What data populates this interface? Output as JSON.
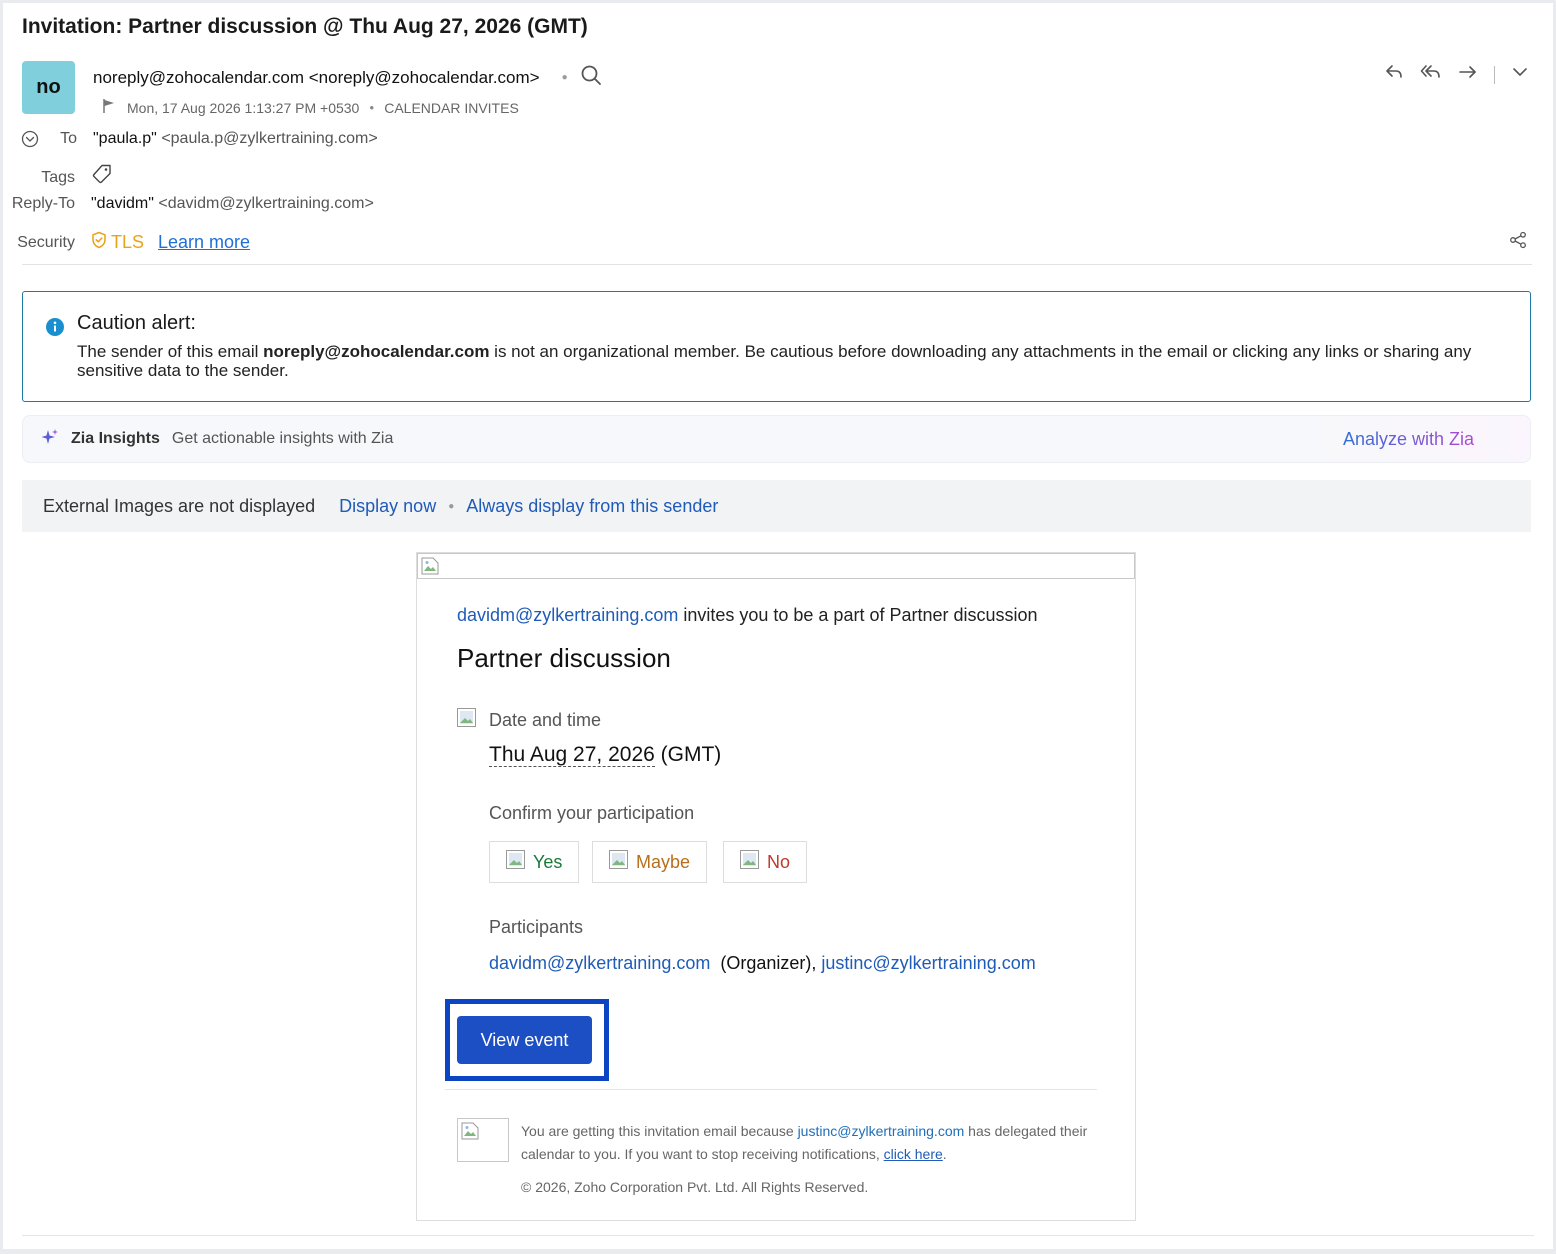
{
  "subject": "Invitation: Partner discussion @ Thu Aug 27, 2026 (GMT)",
  "sender": {
    "avatar": "no",
    "name": "noreply@zohocalendar.com",
    "email": "<noreply@zohocalendar.com>",
    "datetime": "Mon, 17 Aug 2026 1:13:27 PM +0530",
    "folder": "CALENDAR INVITES"
  },
  "headers": {
    "to_label": "To",
    "to_name": "\"paula.p\"",
    "to_email": "<paula.p@zylkertraining.com>",
    "tags_label": "Tags",
    "replyto_label": "Reply-To",
    "replyto_name": "\"davidm\"",
    "replyto_email": "<davidm@zylkertraining.com>",
    "security_label": "Security",
    "tls": "TLS",
    "learn_more": "Learn more"
  },
  "caution": {
    "title": "Caution alert:",
    "text_before": "The sender of this email ",
    "sender": "noreply@zohocalendar.com",
    "text_after": " is not an organizational member. Be cautious before downloading any attachments in the email or clicking any links or sharing any sensitive data to the sender."
  },
  "zia": {
    "name": "Zia Insights",
    "text": "Get actionable insights with Zia",
    "action": "Analyze with Zia"
  },
  "external_images": {
    "message": "External Images are not displayed",
    "display_now": "Display now",
    "always_display": "Always display from this sender"
  },
  "invite": {
    "organizer_email": "davidm@zylkertraining.com",
    "invite_text": " invites you to be a part of Partner discussion",
    "title": "Partner discussion",
    "datetime_label": "Date and time",
    "date": "Thu Aug 27, 2026",
    "timezone": " (GMT)",
    "confirm_label": "Confirm your participation",
    "yes": "Yes",
    "maybe": "Maybe",
    "no": "No",
    "participants_label": "Participants",
    "participant1": "davidm@zylkertraining.com",
    "organizer_tag": "  (Organizer), ",
    "participant2": "justinc@zylkertraining.com",
    "view_event": "View event",
    "footer_before": "You are getting this invitation email because ",
    "footer_email": "justinc@zylkertraining.com",
    "footer_middle": " has delegated their calendar to you. If you want to stop receiving notifications, ",
    "footer_link": "click here",
    "footer_end": ".",
    "copyright": "© 2026, Zoho Corporation Pvt. Ltd. All Rights Reserved."
  },
  "colors": {
    "accent": "#1d4fc4",
    "link": "#1f5bb8",
    "tls": "#e8a317",
    "yes": "#1a7a3a",
    "maybe": "#b86e1c",
    "no": "#c0392b",
    "avatar_bg": "#7fd0dc",
    "caution_border": "#1c7aa5"
  }
}
